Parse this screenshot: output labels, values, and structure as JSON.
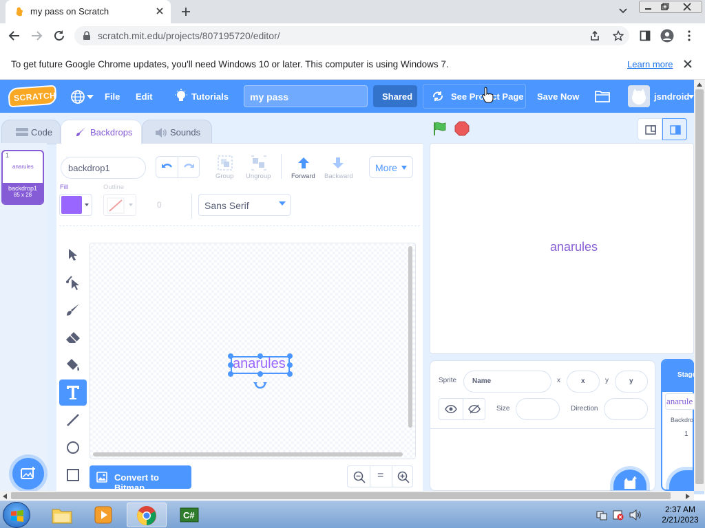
{
  "browser": {
    "tab_title": "my pass on Scratch",
    "url": "scratch.mit.edu/projects/807195720/editor/",
    "infobar_message": "To get future Google Chrome updates, you'll need Windows 10 or later. This computer is using Windows 7.",
    "infobar_link": "Learn more"
  },
  "menubar": {
    "logo": "SCRATCH",
    "file": "File",
    "edit": "Edit",
    "tutorials": "Tutorials",
    "project_title": "my pass",
    "shared": "Shared",
    "see_project_page": "See Project Page",
    "save_now": "Save Now",
    "username": "jsndroid"
  },
  "editor_tabs": {
    "code": "Code",
    "backdrops": "Backdrops",
    "sounds": "Sounds"
  },
  "backdrop_list": {
    "number": "1",
    "thumb_text": "anarules",
    "name": "backdrop1",
    "size": "85 x 28"
  },
  "paint": {
    "costume_name": "backdrop1",
    "group": "Group",
    "ungroup": "Ungroup",
    "forward": "Forward",
    "backward": "Backward",
    "more": "More",
    "fill_label": "Fill",
    "outline_label": "Outline",
    "outline_width": "0",
    "font": "Sans Serif",
    "canvas_text": "anarules",
    "convert_button": "Convert to Bitmap",
    "fill_color": "#9966ff",
    "zoom_reset": "="
  },
  "stage": {
    "text": "anarules"
  },
  "sprite_info": {
    "sprite_label": "Sprite",
    "name_placeholder": "Name",
    "x_label": "x",
    "x_placeholder": "x",
    "y_label": "y",
    "y_placeholder": "y",
    "size_label": "Size",
    "direction_label": "Direction"
  },
  "stage_panel": {
    "title": "Stage",
    "thumb_text": "anarule",
    "backdrops_label": "Backdro",
    "count": "1"
  },
  "taskbar": {
    "time": "2:37 AM",
    "date": "2/21/2023"
  },
  "colors": {
    "scratch_blue": "#4c97ff",
    "scratch_purple": "#855cd6",
    "green_flag": "#4cbf56",
    "stop": "#ec5959"
  }
}
